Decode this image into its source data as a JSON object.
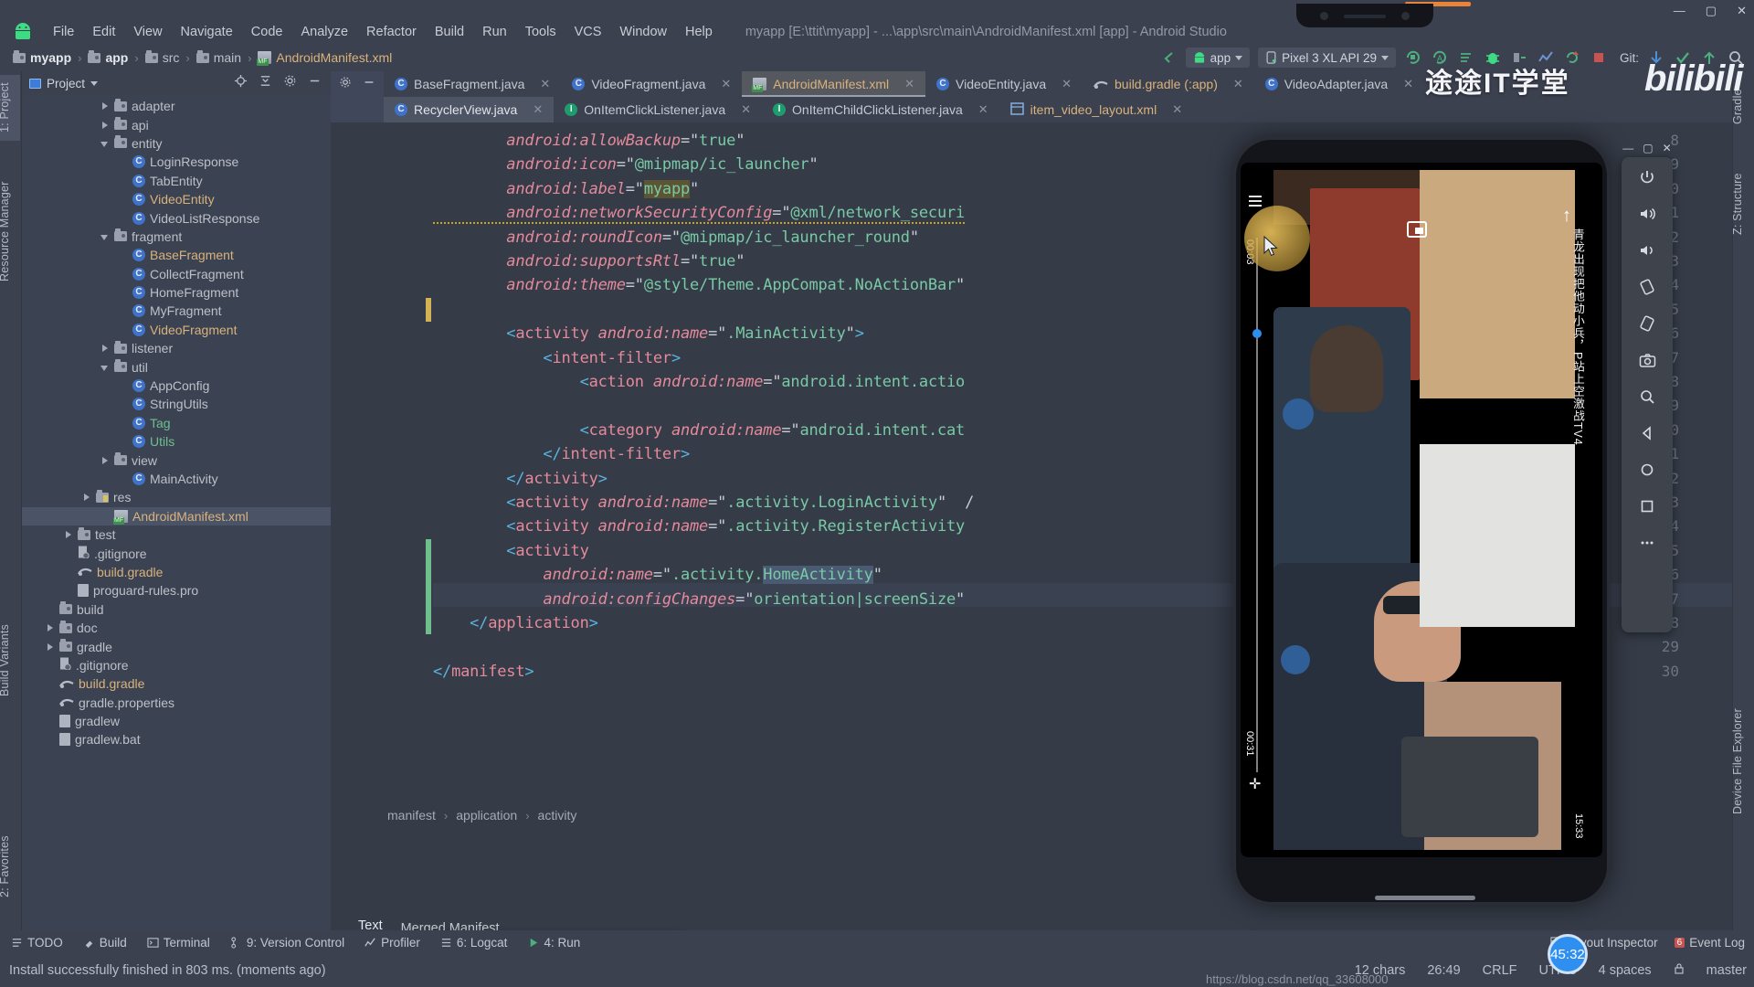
{
  "window": {
    "title": "myapp [E:\\ttit\\myapp] - ...\\app\\src\\main\\AndroidManifest.xml [app] - Android Studio",
    "minimize": "—",
    "maximize": "▢",
    "close": "✕"
  },
  "menubar": {
    "items": [
      "File",
      "Edit",
      "View",
      "Navigate",
      "Code",
      "Analyze",
      "Refactor",
      "Build",
      "Run",
      "Tools",
      "VCS",
      "Window",
      "Help"
    ]
  },
  "toolbar": {
    "breadcrumb": [
      "myapp",
      "app",
      "src",
      "main",
      "AndroidManifest.xml"
    ],
    "run_config": "app",
    "device": "Pixel 3 XL API 29",
    "git_label": "Git:"
  },
  "left_strip": {
    "tabs": [
      "1: Project",
      "Resource Manager",
      "Build Variants",
      "2: Favorites"
    ]
  },
  "right_strip": {
    "tabs": [
      "Gradle",
      "Z: Structure",
      "Device File Explorer"
    ]
  },
  "project_panel": {
    "title": "Project",
    "tree": [
      {
        "label": "adapter",
        "indent": 4,
        "arrow": "right",
        "icon": "folder-icon",
        "color": "white"
      },
      {
        "label": "api",
        "indent": 4,
        "arrow": "right",
        "icon": "folder-icon",
        "color": "white"
      },
      {
        "label": "entity",
        "indent": 4,
        "arrow": "down",
        "icon": "folder-icon",
        "color": "white"
      },
      {
        "label": "LoginResponse",
        "indent": 5,
        "arrow": "none",
        "icon": "class-icon",
        "color": "white"
      },
      {
        "label": "TabEntity",
        "indent": 5,
        "arrow": "none",
        "icon": "class-icon",
        "color": "white"
      },
      {
        "label": "VideoEntity",
        "indent": 5,
        "arrow": "none",
        "icon": "class-icon",
        "color": "yellow"
      },
      {
        "label": "VideoListResponse",
        "indent": 5,
        "arrow": "none",
        "icon": "class-icon",
        "color": "white"
      },
      {
        "label": "fragment",
        "indent": 4,
        "arrow": "down",
        "icon": "folder-icon",
        "color": "white"
      },
      {
        "label": "BaseFragment",
        "indent": 5,
        "arrow": "none",
        "icon": "class-icon",
        "color": "yellow"
      },
      {
        "label": "CollectFragment",
        "indent": 5,
        "arrow": "none",
        "icon": "class-icon",
        "color": "white"
      },
      {
        "label": "HomeFragment",
        "indent": 5,
        "arrow": "none",
        "icon": "class-icon",
        "color": "white"
      },
      {
        "label": "MyFragment",
        "indent": 5,
        "arrow": "none",
        "icon": "class-icon",
        "color": "white"
      },
      {
        "label": "VideoFragment",
        "indent": 5,
        "arrow": "none",
        "icon": "class-icon",
        "color": "yellow"
      },
      {
        "label": "listener",
        "indent": 4,
        "arrow": "right",
        "icon": "folder-icon",
        "color": "white"
      },
      {
        "label": "util",
        "indent": 4,
        "arrow": "down",
        "icon": "folder-icon",
        "color": "white"
      },
      {
        "label": "AppConfig",
        "indent": 5,
        "arrow": "none",
        "icon": "class-icon",
        "color": "white"
      },
      {
        "label": "StringUtils",
        "indent": 5,
        "arrow": "none",
        "icon": "class-icon",
        "color": "white"
      },
      {
        "label": "Tag",
        "indent": 5,
        "arrow": "none",
        "icon": "class-icon",
        "color": "green"
      },
      {
        "label": "Utils",
        "indent": 5,
        "arrow": "none",
        "icon": "class-icon",
        "color": "green"
      },
      {
        "label": "view",
        "indent": 4,
        "arrow": "right",
        "icon": "folder-icon",
        "color": "white"
      },
      {
        "label": "MainActivity",
        "indent": 5,
        "arrow": "none",
        "icon": "class-icon",
        "color": "white"
      },
      {
        "label": "res",
        "indent": 3,
        "arrow": "right",
        "icon": "res-folder-icon",
        "color": "white"
      },
      {
        "label": "AndroidManifest.xml",
        "indent": 4,
        "arrow": "none",
        "icon": "manifest-icon",
        "color": "yellow",
        "selected": true
      },
      {
        "label": "test",
        "indent": 2,
        "arrow": "right",
        "icon": "folder-icon",
        "color": "white"
      },
      {
        "label": ".gitignore",
        "indent": 2,
        "arrow": "none",
        "icon": "gitignore-icon",
        "color": "white"
      },
      {
        "label": "build.gradle",
        "indent": 2,
        "arrow": "none",
        "icon": "gradle-icon",
        "color": "yellow"
      },
      {
        "label": "proguard-rules.pro",
        "indent": 2,
        "arrow": "none",
        "icon": "file-icon",
        "color": "white"
      },
      {
        "label": "build",
        "indent": 1,
        "arrow": "none",
        "icon": "folder-icon",
        "color": "white"
      },
      {
        "label": "doc",
        "indent": 1,
        "arrow": "right",
        "icon": "folder-icon",
        "color": "white"
      },
      {
        "label": "gradle",
        "indent": 1,
        "arrow": "right",
        "icon": "folder-icon",
        "color": "white"
      },
      {
        "label": ".gitignore",
        "indent": 1,
        "arrow": "none",
        "icon": "gitignore-icon",
        "color": "white"
      },
      {
        "label": "build.gradle",
        "indent": 1,
        "arrow": "none",
        "icon": "gradle-icon",
        "color": "yellow"
      },
      {
        "label": "gradle.properties",
        "indent": 1,
        "arrow": "none",
        "icon": "gradle-icon",
        "color": "white"
      },
      {
        "label": "gradlew",
        "indent": 1,
        "arrow": "none",
        "icon": "file-icon",
        "color": "white"
      },
      {
        "label": "gradlew.bat",
        "indent": 1,
        "arrow": "none",
        "icon": "file-icon",
        "color": "white"
      }
    ]
  },
  "editor": {
    "tabs_row1": [
      {
        "label": "BaseFragment.java",
        "icon": "class-icon",
        "active": false
      },
      {
        "label": "VideoFragment.java",
        "icon": "class-icon",
        "active": false
      },
      {
        "label": "AndroidManifest.xml",
        "icon": "manifest-icon",
        "active": true
      },
      {
        "label": "VideoEntity.java",
        "icon": "class-icon",
        "active": false
      },
      {
        "label": "build.gradle (:app)",
        "icon": "gradle-icon",
        "active": false
      },
      {
        "label": "VideoAdapter.java",
        "icon": "class-icon",
        "active": false
      }
    ],
    "tabs_row2": [
      {
        "label": "RecyclerView.java",
        "icon": "class-icon",
        "active": true
      },
      {
        "label": "OnItemClickListener.java",
        "icon": "interface-icon",
        "active": false
      },
      {
        "label": "OnItemChildClickListener.java",
        "icon": "interface-icon",
        "active": false
      },
      {
        "label": "item_video_layout.xml",
        "icon": "layout-icon",
        "active": false
      }
    ],
    "lines": [
      {
        "n": 8,
        "text": "        android:allowBackup=\"true\""
      },
      {
        "n": 9,
        "text": "        android:icon=\"@mipmap/ic_launcher\""
      },
      {
        "n": 10,
        "text": "        android:label=\"myapp\""
      },
      {
        "n": 11,
        "text": "        android:networkSecurityConfig=\"@xml/network_securi"
      },
      {
        "n": 12,
        "text": "        android:roundIcon=\"@mipmap/ic_launcher_round\""
      },
      {
        "n": 13,
        "text": "        android:supportsRtl=\"true\""
      },
      {
        "n": 14,
        "text": "        android:theme=\"@style/Theme.AppCompat.NoActionBar\""
      },
      {
        "n": 15,
        "text": ""
      },
      {
        "n": 16,
        "text": "        <activity android:name=\".MainActivity\">"
      },
      {
        "n": 17,
        "text": "            <intent-filter>"
      },
      {
        "n": 18,
        "text": "                <action android:name=\"android.intent.actio"
      },
      {
        "n": 19,
        "text": ""
      },
      {
        "n": 20,
        "text": "                <category android:name=\"android.intent.cat"
      },
      {
        "n": 21,
        "text": "            </intent-filter>"
      },
      {
        "n": 22,
        "text": "        </activity>"
      },
      {
        "n": 23,
        "text": "        <activity android:name=\".activity.LoginActivity\"  /"
      },
      {
        "n": 24,
        "text": "        <activity android:name=\".activity.RegisterActivity"
      },
      {
        "n": 25,
        "text": "        <activity"
      },
      {
        "n": 26,
        "text": "            android:name=\".activity.HomeActivity\""
      },
      {
        "n": 27,
        "text": "            android:configChanges=\"orientation|screenSize\""
      },
      {
        "n": 28,
        "text": "    </application>"
      },
      {
        "n": 29,
        "text": ""
      },
      {
        "n": 30,
        "text": "</manifest>"
      }
    ],
    "breadcrumb_bottom": [
      "manifest",
      "application",
      "activity"
    ],
    "bottom_tabs": [
      "Text",
      "Merged Manifest"
    ],
    "selected_token": "HomeActivity"
  },
  "tooltip": {
    "text": "Install successfully finished in 803 ms."
  },
  "bottom_toolwindows": {
    "left": [
      "TODO",
      "Build",
      "Terminal",
      "9: Version Control",
      "Profiler",
      "6: Logcat",
      "4: Run"
    ],
    "right": [
      "Layout Inspector",
      "Event Log"
    ],
    "event_log_badge": "6"
  },
  "statusbar": {
    "message": "Install successfully finished in 803 ms. (moments ago)",
    "chars": "12 chars",
    "caret": "26:49",
    "line_sep": "CRLF",
    "encoding": "UTF-8",
    "indent": "4 spaces",
    "branch": "master",
    "url": "https://blog.csdn.net/qq_33608000"
  },
  "emulator": {
    "device_name": "Pixel 3 XL API 29",
    "time_current": "00:03",
    "time_start": "00:31",
    "time_total": "15:33",
    "overlay_text": "青龙出现把他动小兵，P站上空激战TV4",
    "toolbar_icons": [
      "power-icon",
      "volume-up-icon",
      "volume-down-icon",
      "rotate-left-icon",
      "rotate-right-icon",
      "screenshot-icon",
      "zoom-icon",
      "back-icon",
      "home-icon",
      "overview-icon",
      "more-icon"
    ],
    "window_controls": [
      "—",
      "▢",
      "✕"
    ],
    "badge": "45:32"
  },
  "watermark": {
    "text": "途途IT学堂",
    "brand": "bilibili"
  }
}
